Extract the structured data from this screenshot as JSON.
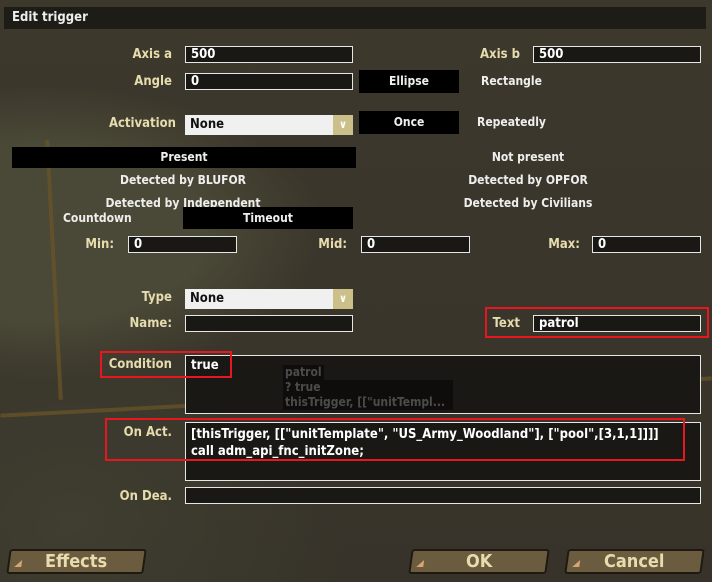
{
  "title": "Edit trigger",
  "shape": {
    "axis_a_label": "Axis a",
    "axis_a": "500",
    "axis_b_label": "Axis b",
    "axis_b": "500",
    "angle_label": "Angle",
    "angle": "0",
    "ellipse": "Ellipse",
    "rectangle": "Rectangle"
  },
  "activation": {
    "label": "Activation",
    "value": "None",
    "once": "Once",
    "repeatedly": "Repeatedly"
  },
  "presence": {
    "present": "Present",
    "not_present": "Not present",
    "blufor": "Detected by BLUFOR",
    "opfor": "Detected by OPFOR",
    "independent": "Detected by Independent",
    "civilians": "Detected by Civilians"
  },
  "timer": {
    "countdown": "Countdown",
    "timeout": "Timeout",
    "min_label": "Min:",
    "min": "0",
    "mid_label": "Mid:",
    "mid": "0",
    "max_label": "Max:",
    "max": "0"
  },
  "type": {
    "label": "Type",
    "value": "None"
  },
  "name": {
    "label": "Name:",
    "value": ""
  },
  "text": {
    "label": "Text",
    "value": "patrol"
  },
  "condition": {
    "label": "Condition",
    "value": "true"
  },
  "on_act": {
    "label": "On Act.",
    "value": "[thisTrigger, [[\"unitTemplate\", \"US_Army_Woodland\"], [\"pool\",[3,1,1]]]]\ncall adm_api_fnc_initZone;"
  },
  "on_dea": {
    "label": "On Dea.",
    "value": ""
  },
  "map_tooltip": {
    "line1": "patrol",
    "line2": "? true",
    "line3": "thisTrigger, [[\"unitTempl..."
  },
  "buttons": {
    "effects": "Effects",
    "ok": "OK",
    "cancel": "Cancel"
  },
  "colors": {
    "label": "#e6dcae",
    "highlight": "#e8161e",
    "button": "#6b5c3f"
  }
}
